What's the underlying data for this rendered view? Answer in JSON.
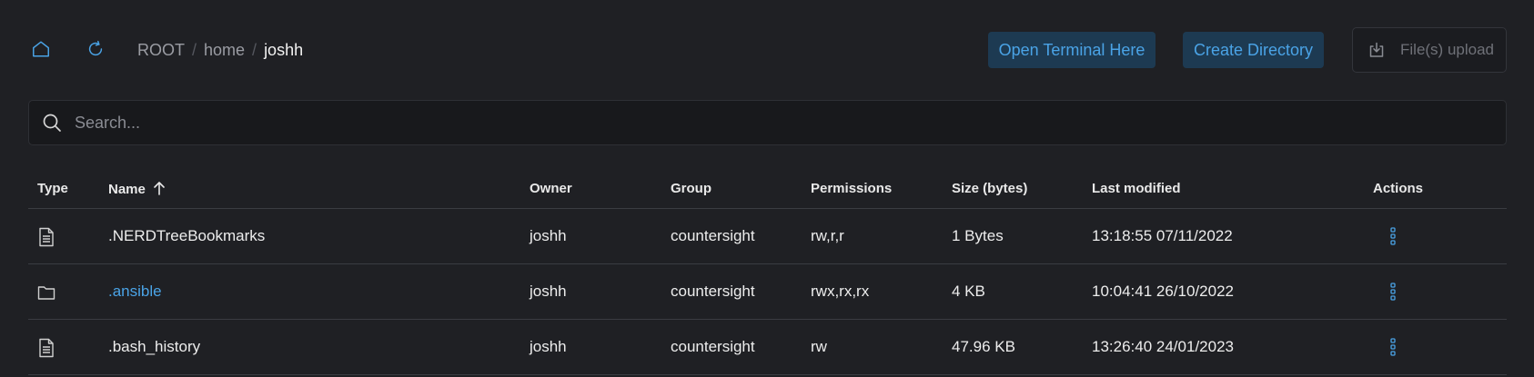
{
  "toolbar": {
    "icons": {
      "home": "home-icon",
      "refresh": "refresh-icon"
    },
    "breadcrumb": [
      "ROOT",
      "home",
      "joshh"
    ],
    "separator": "/",
    "open_terminal_label": "Open Terminal Here",
    "create_directory_label": "Create Directory",
    "upload_label": "File(s) upload"
  },
  "search": {
    "placeholder": "Search..."
  },
  "table": {
    "headers": {
      "type": "Type",
      "name": "Name",
      "owner": "Owner",
      "group": "Group",
      "permissions": "Permissions",
      "size": "Size (bytes)",
      "modified": "Last modified",
      "actions": "Actions"
    },
    "sort": {
      "column": "name",
      "direction": "ascending"
    },
    "rows": [
      {
        "type": "file",
        "name": ".NERDTreeBookmarks",
        "owner": "joshh",
        "group": "countersight",
        "permissions": "rw,r,r",
        "size": "1 Bytes",
        "modified": "13:18:55 07/11/2022"
      },
      {
        "type": "folder",
        "name": ".ansible",
        "owner": "joshh",
        "group": "countersight",
        "permissions": "rwx,rx,rx",
        "size": "4 KB",
        "modified": "10:04:41 26/10/2022"
      },
      {
        "type": "file",
        "name": ".bash_history",
        "owner": "joshh",
        "group": "countersight",
        "permissions": "rw",
        "size": "47.96 KB",
        "modified": "13:26:40 24/01/2023"
      }
    ]
  },
  "colors": {
    "background": "#1f2024",
    "accent": "#4aa3e6",
    "button_bg": "#1d3a52",
    "divider": "#3a3c42"
  }
}
